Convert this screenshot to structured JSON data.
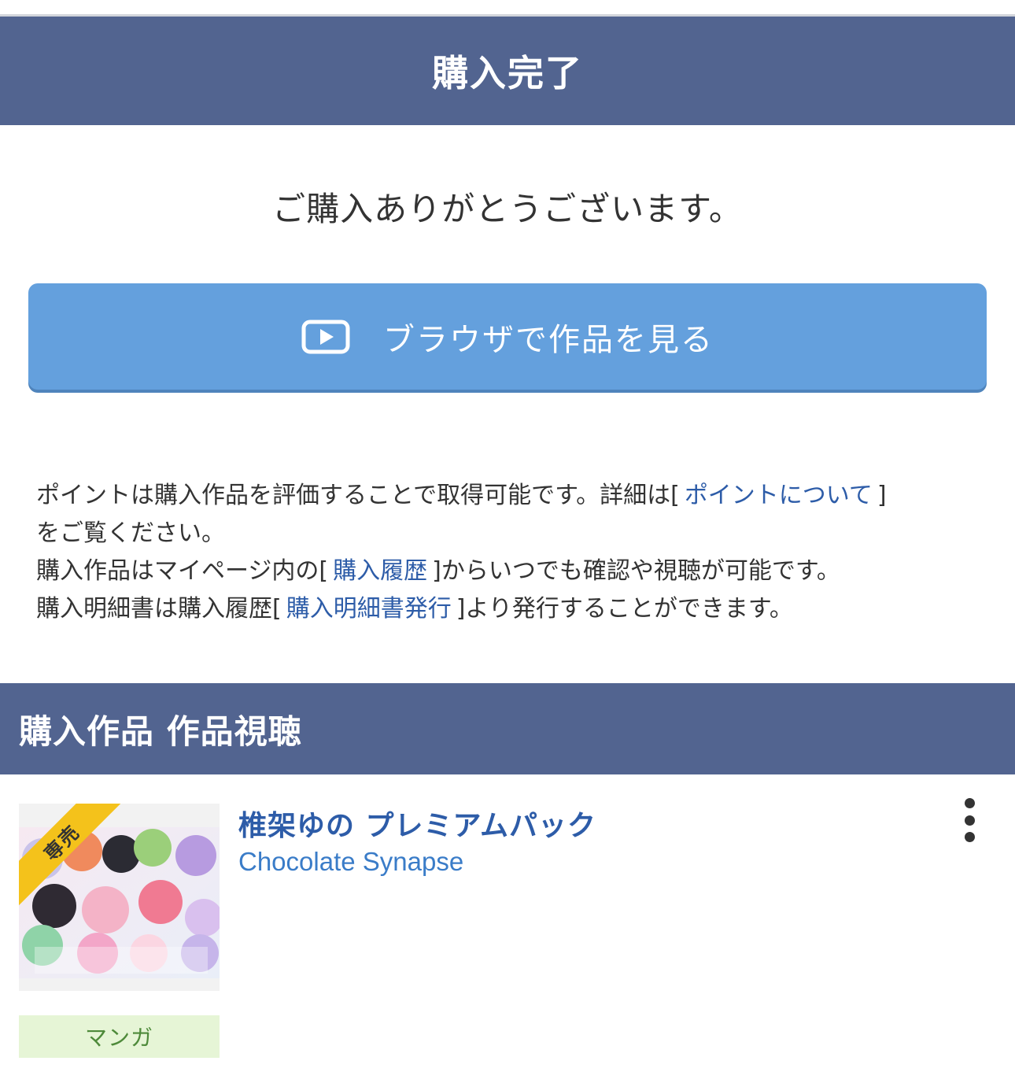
{
  "header": {
    "title": "購入完了"
  },
  "thanks_message": "ご購入ありがとうございます。",
  "view_button": {
    "label": "ブラウザで作品を見る",
    "icon": "play-icon"
  },
  "info": {
    "line1_prefix": "ポイントは購入作品を評価することで取得可能です。詳細は[",
    "points_link": "ポイントについて",
    "line1_suffix": "]",
    "line2": "をご覧ください。",
    "line3_prefix": "購入作品はマイページ内の[",
    "history_link": "購入履歴",
    "line3_suffix": "]からいつでも確認や視聴が可能です。",
    "line4_prefix": "購入明細書は購入履歴[",
    "receipt_link": "購入明細書発行",
    "line4_suffix": "]より発行することができます。"
  },
  "section": {
    "title": "購入作品 作品視聴"
  },
  "item": {
    "exclusive_label": "専売",
    "thumbnail_text": "椎架ゆのプレミアムパック",
    "title": "椎架ゆの プレミアムパック",
    "circle": "Chocolate Synapse",
    "category": "マンガ",
    "menu_icon": "kebab-menu-icon"
  },
  "colors": {
    "header_bg": "#526490",
    "button_bg": "#64a0dd",
    "link": "#2d5ca8",
    "ribbon": "#f4c21b",
    "category_bg": "#e6f5d6"
  }
}
